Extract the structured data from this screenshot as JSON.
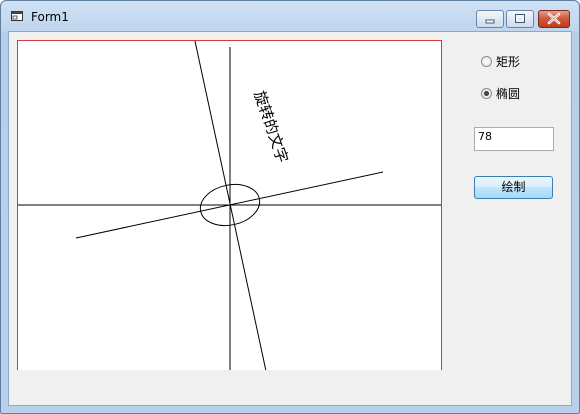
{
  "window": {
    "title": "Form1"
  },
  "options": [
    {
      "label": "矩形",
      "selected": false
    },
    {
      "label": "椭圆",
      "selected": true
    }
  ],
  "angle_input": {
    "value": "78"
  },
  "draw_button": {
    "label": "绘制"
  },
  "canvas": {
    "rotated_text": "旋转的文字",
    "border_color": "#d23a3a"
  }
}
